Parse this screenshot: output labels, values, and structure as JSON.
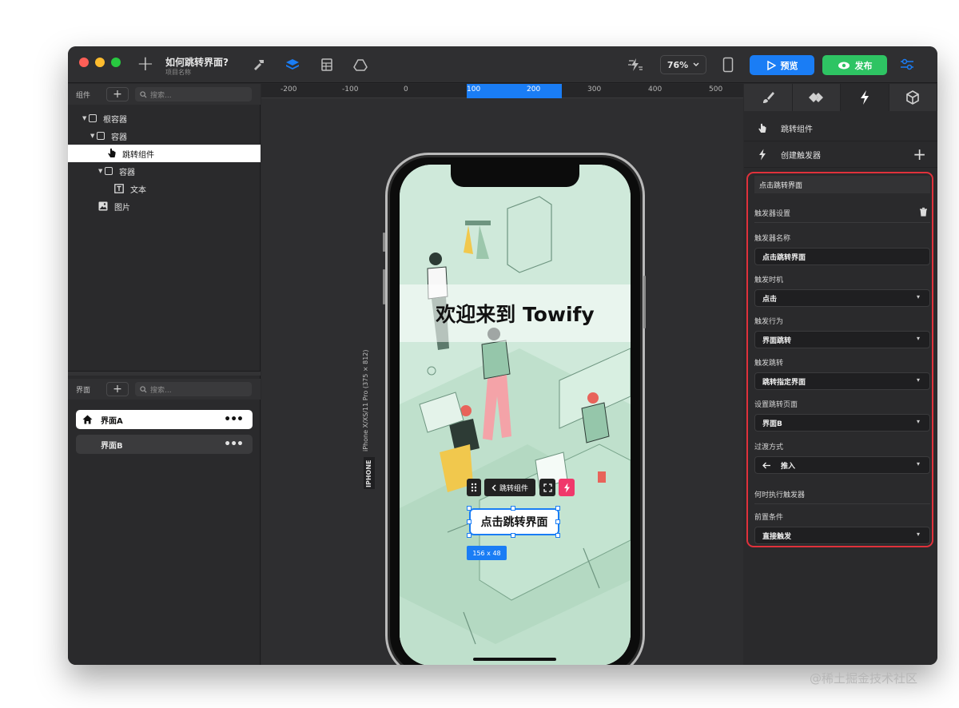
{
  "titlebar": {
    "project_title": "如何跳转界面?",
    "project_subtitle": "项目名称",
    "zoom": "76%",
    "preview_label": "预览",
    "publish_label": "发布"
  },
  "components_panel": {
    "label": "组件",
    "search_placeholder": "搜索...",
    "tree": [
      {
        "label": "根容器"
      },
      {
        "label": "容器"
      },
      {
        "label": "跳转组件"
      },
      {
        "label": "容器"
      },
      {
        "label": "文本"
      },
      {
        "label": "图片"
      }
    ]
  },
  "screens_panel": {
    "label": "界面",
    "search_placeholder": "搜索...",
    "items": [
      {
        "label": "界面A"
      },
      {
        "label": "界面B"
      }
    ]
  },
  "ruler": {
    "ticks": [
      "-200",
      "-100",
      "0",
      "100",
      "200",
      "300",
      "400",
      "500"
    ]
  },
  "canvas": {
    "device_label": "iPhone X/XS/11 Pro (375 × 812)",
    "device_tag": "IPHONE",
    "welcome_text": "欢迎来到 Towify",
    "button_text": "点击跳转界面",
    "toolbar_label": "跳转组件",
    "size_badge": "156 x 48"
  },
  "inspector": {
    "component_name": "跳转组件",
    "create_trigger_label": "创建触发器",
    "trigger": {
      "title": "点击跳转界面",
      "settings_label": "触发器设置",
      "name_label": "触发器名称",
      "name_value": "点击跳转界面",
      "timing_label": "触发时机",
      "timing_value": "点击",
      "action_label": "触发行为",
      "action_value": "界面跳转",
      "jump_label": "触发跳转",
      "jump_value": "跳转指定界面",
      "page_label": "设置跳转页面",
      "page_value": "界面B",
      "transition_label": "过渡方式",
      "transition_value": "推入",
      "when_label": "何时执行触发器",
      "precondition_label": "前置条件",
      "precondition_value": "直接触发"
    }
  },
  "watermark": "@稀土掘金技术社区",
  "colors": {
    "accent": "#1a7df5",
    "publish": "#2ec463",
    "highlight": "#e0313b",
    "lightning": "#f0386b"
  }
}
